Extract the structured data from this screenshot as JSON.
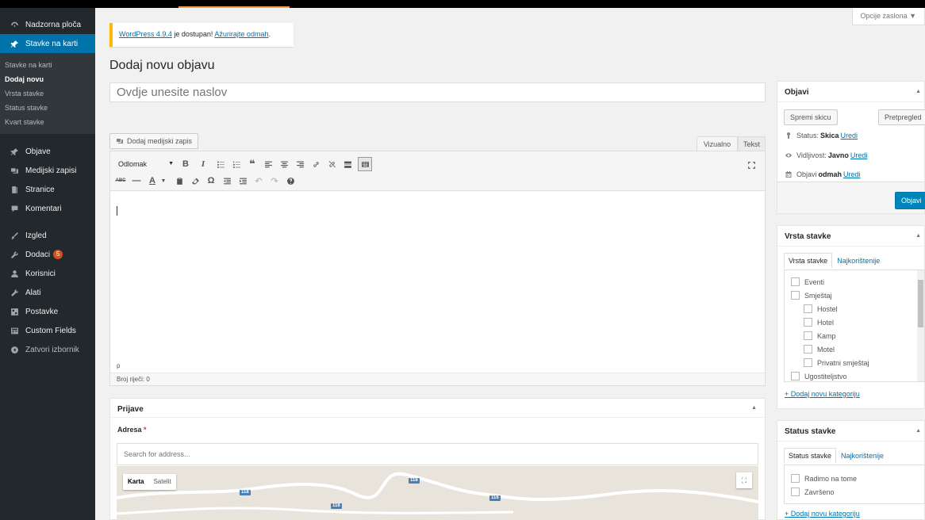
{
  "sidebar": {
    "items_top": [
      {
        "label": "Nadzorna ploča",
        "icon": "dashboard-icon"
      },
      {
        "label": "Stavke na karti",
        "icon": "pin-icon"
      }
    ],
    "submenu": [
      {
        "label": "Stavke na karti"
      },
      {
        "label": "Dodaj novu"
      },
      {
        "label": "Vrsta stavke"
      },
      {
        "label": "Status stavke"
      },
      {
        "label": "Kvart stavke"
      }
    ],
    "items_mid": [
      {
        "label": "Objave",
        "icon": "pin-icon"
      },
      {
        "label": "Medijski zapisi",
        "icon": "media-icon"
      },
      {
        "label": "Stranice",
        "icon": "page-icon"
      },
      {
        "label": "Komentari",
        "icon": "comment-icon"
      }
    ],
    "items_bottom": [
      {
        "label": "Izgled",
        "icon": "brush-icon"
      },
      {
        "label": "Dodaci",
        "icon": "plugin-icon",
        "badge": "5"
      },
      {
        "label": "Korisnici",
        "icon": "users-icon"
      },
      {
        "label": "Alati",
        "icon": "wrench-icon"
      },
      {
        "label": "Postavke",
        "icon": "settings-icon"
      },
      {
        "label": "Custom Fields",
        "icon": "fields-icon"
      },
      {
        "label": "Zatvori izbornik",
        "icon": "collapse-icon"
      }
    ]
  },
  "screen_options": "Opcije zaslona ▼",
  "notice": {
    "link1": "WordPress 4.9.4",
    "text": " je dostupan! ",
    "link2": "Ažurirajte odmah",
    "end": "."
  },
  "page_title": "Dodaj novu objavu",
  "title_placeholder": "Ovdje unesite naslov",
  "add_media": "Dodaj medijski zapis",
  "editor": {
    "tab_visual": "Vizualno",
    "tab_text": "Tekst",
    "format": "Odlomak",
    "path": "p",
    "wordcount": "Broj riječi: 0"
  },
  "prijave": {
    "title": "Prijave",
    "address_label": "Adresa",
    "required": "*",
    "address_placeholder": "Search for address...",
    "map_karta": "Karta",
    "map_satelit": "Satelit",
    "road": "118"
  },
  "objavi": {
    "title": "Objavi",
    "save_draft": "Spremi skicu",
    "preview": "Pretpregled",
    "status_label": "Status:",
    "status_value": "Skica",
    "visibility_label": "Vidljivost:",
    "visibility_value": "Javno",
    "publish_label": "Objavi",
    "publish_value": "odmah",
    "edit": "Uredi",
    "publish_button": "Objavi"
  },
  "vrsta": {
    "title": "Vrsta stavke",
    "tab_all": "Vrsta stavke",
    "tab_popular": "Najkorištenije",
    "categories": [
      {
        "label": "Eventi",
        "level": 0
      },
      {
        "label": "Smještaj",
        "level": 0
      },
      {
        "label": "Hostel",
        "level": 1
      },
      {
        "label": "Hotel",
        "level": 1
      },
      {
        "label": "Kamp",
        "level": 1
      },
      {
        "label": "Motel",
        "level": 1
      },
      {
        "label": "Privatni smještaj",
        "level": 1
      },
      {
        "label": "Ugostiteljstvo",
        "level": 0
      }
    ],
    "add_new": "+ Dodaj novu kategoriju"
  },
  "status": {
    "title": "Status stavke",
    "tab_all": "Status stavke",
    "tab_popular": "Najkorištenije",
    "categories": [
      {
        "label": "Radimo na tome",
        "level": 0
      },
      {
        "label": "Završeno",
        "level": 0
      }
    ],
    "add_new": "+ Dodaj novu kategoriju"
  }
}
